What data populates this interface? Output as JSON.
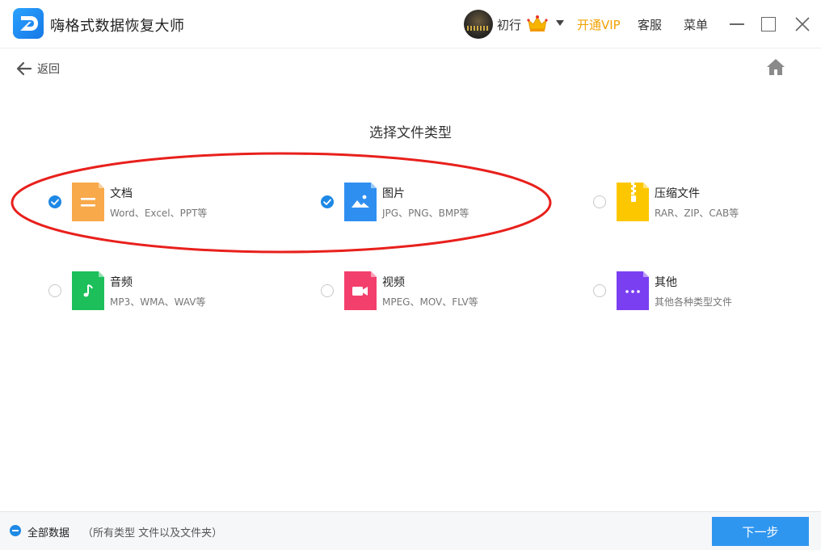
{
  "app": {
    "title": "嗨格式数据恢复大师",
    "username": "初行",
    "vip_label": "开通VIP",
    "service_label": "客服",
    "menu_label": "菜单"
  },
  "nav": {
    "back_label": "返回"
  },
  "main": {
    "title": "选择文件类型",
    "file_types": [
      {
        "name": "文档",
        "desc": "Word、Excel、PPT等",
        "checked": true,
        "color": "#f8a94a",
        "icon": "document-icon"
      },
      {
        "name": "图片",
        "desc": "JPG、PNG、BMP等",
        "checked": true,
        "color": "#2f8ff0",
        "icon": "image-icon"
      },
      {
        "name": "压缩文件",
        "desc": "RAR、ZIP、CAB等",
        "checked": false,
        "color": "#fdc700",
        "icon": "zip-icon"
      },
      {
        "name": "音频",
        "desc": "MP3、WMA、WAV等",
        "checked": false,
        "color": "#1dbf5b",
        "icon": "music-icon"
      },
      {
        "name": "视频",
        "desc": "MPEG、MOV、FLV等",
        "checked": false,
        "color": "#f33f6c",
        "icon": "video-icon"
      },
      {
        "name": "其他",
        "desc": "其他各种类型文件",
        "checked": false,
        "color": "#7b3ff2",
        "icon": "more-icon"
      }
    ]
  },
  "footer": {
    "all_data_label": "全部数据",
    "all_data_desc": "（所有类型 文件以及文件夹）",
    "next_label": "下一步"
  },
  "colors": {
    "accent": "#2f96f0",
    "vip": "#f2a100",
    "annotation": "#e8201c"
  }
}
